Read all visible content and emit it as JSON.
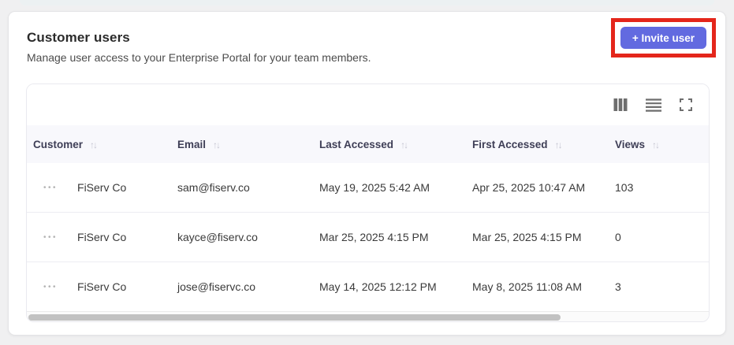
{
  "header": {
    "title": "Customer users",
    "subtitle": "Manage user access to your Enterprise Portal for your team members.",
    "invite_button_label": "+ Invite user"
  },
  "icons": {
    "sort": "↑↓",
    "row_actions": "•••"
  },
  "colors": {
    "accent": "#626ae0",
    "annotation_highlight": "#e4261b",
    "header_bg": "#f8f8fc"
  },
  "table": {
    "columns": [
      {
        "label": "Customer",
        "sortable": true
      },
      {
        "label": "Email",
        "sortable": true
      },
      {
        "label": "Last Accessed",
        "sortable": true
      },
      {
        "label": "First Accessed",
        "sortable": true
      },
      {
        "label": "Views",
        "sortable": true
      }
    ],
    "rows": [
      {
        "customer": "FiServ Co",
        "email": "sam@fiserv.co",
        "last_accessed": "May 19, 2025 5:42 AM",
        "first_accessed": "Apr 25, 2025 10:47 AM",
        "views": "103"
      },
      {
        "customer": "FiServ Co",
        "email": "kayce@fiserv.co",
        "last_accessed": "Mar 25, 2025 4:15 PM",
        "first_accessed": "Mar 25, 2025 4:15 PM",
        "views": "0"
      },
      {
        "customer": "FiServ Co",
        "email": "jose@fiservc.co",
        "last_accessed": "May 14, 2025 12:12 PM",
        "first_accessed": "May 8, 2025 11:08 AM",
        "views": "3"
      }
    ]
  }
}
